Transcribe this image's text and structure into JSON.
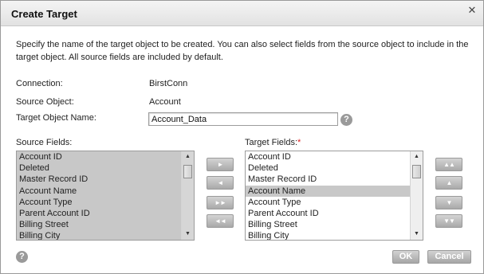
{
  "dialog": {
    "title": "Create Target",
    "description": "Specify the name of the target object to be created. You can also select fields from the source object to include in the target object. All source fields are included by default."
  },
  "connection": {
    "label": "Connection:",
    "value": "BirstConn"
  },
  "source_object": {
    "label": "Source Object:",
    "value": "Account"
  },
  "target_object_name": {
    "label": "Target Object Name:",
    "value": "Account_Data"
  },
  "source_fields": {
    "label": "Source Fields:",
    "items": [
      "Account ID",
      "Deleted",
      "Master Record ID",
      "Account Name",
      "Account Type",
      "Parent Account ID",
      "Billing Street",
      "Billing City"
    ]
  },
  "target_fields": {
    "label": "Target Fields:",
    "required_marker": "*",
    "items": [
      "Account ID",
      "Deleted",
      "Master Record ID",
      "Account Name",
      "Account Type",
      "Parent Account ID",
      "Billing Street",
      "Billing City"
    ],
    "selected": "Account Name"
  },
  "move_buttons": {
    "add_one": "►",
    "remove_one": "◄",
    "add_all": "►►",
    "remove_all": "◄◄"
  },
  "order_buttons": {
    "top": "▲▲",
    "up": "▲",
    "down": "▼",
    "bottom": "▼▼"
  },
  "footer": {
    "ok_label": "OK",
    "cancel_label": "Cancel"
  },
  "icons": {
    "help": "?",
    "close": "✕",
    "scroll_up": "▲",
    "scroll_down": "▼"
  }
}
